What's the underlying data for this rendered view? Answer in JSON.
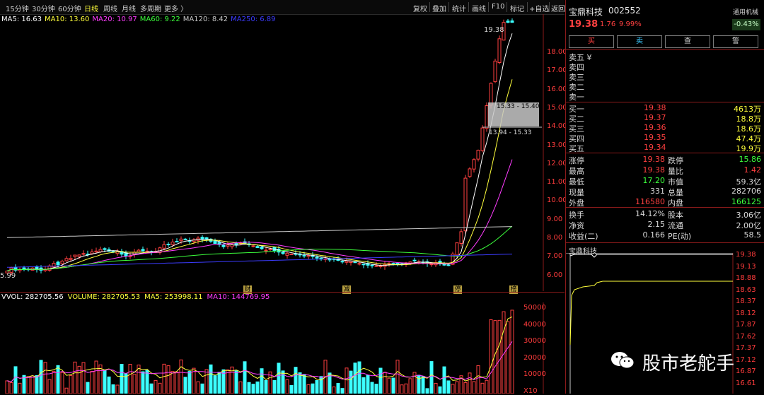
{
  "toolbar": {
    "periods": [
      "15分钟",
      "30分钟",
      "60分钟",
      "日线",
      "周线",
      "月线",
      "多周期",
      "更多 〉"
    ],
    "active_period": "日线",
    "buttons": [
      "复权",
      "叠加",
      "统计",
      "画线",
      "F10",
      "标记",
      "+自选",
      "返回"
    ]
  },
  "ma_legend": [
    {
      "label": "MA5: 16.63",
      "color": "#ffffff"
    },
    {
      "label": "MA10: 13.60",
      "color": "#ffff3c"
    },
    {
      "label": "MA20: 10.97",
      "color": "#ff3cff"
    },
    {
      "label": "MA60: 9.22",
      "color": "#3cff3c"
    },
    {
      "label": "MA120: 8.42",
      "color": "#c8c8c8"
    },
    {
      "label": "MA250: 6.89",
      "color": "#3c3cff"
    }
  ],
  "price_axis": [
    "18.00",
    "17.00",
    "16.00",
    "15.00",
    "14.00",
    "13.00",
    "12.00",
    "11.00",
    "10.00",
    "9.00",
    "8.00",
    "7.00",
    "6.00"
  ],
  "chart_annotations": {
    "high_label": "19.38",
    "low_label": "5.99",
    "range1": "15.33 - 15.40",
    "range2": "13.94 - 15.33"
  },
  "event_markers": [
    "财",
    "减",
    "停",
    "榜"
  ],
  "vol_legend": [
    {
      "label": "VVOL: 282705.56",
      "color": "#ffffff"
    },
    {
      "label": "VOLUME: 282705.53",
      "color": "#ffff3c"
    },
    {
      "label": "MA5: 253998.11",
      "color": "#ffff3c"
    },
    {
      "label": "MA10: 144769.95",
      "color": "#ff3cff"
    }
  ],
  "vol_axis": [
    "50000",
    "40000",
    "30000",
    "20000",
    "10000",
    "X10"
  ],
  "stock": {
    "name": "宝鼎科技",
    "code": "002552",
    "sector": "通用机械",
    "sector_pct": "-0.43%",
    "price": "19.38",
    "change": "1.76",
    "change_pct": "9.99%"
  },
  "trade_buttons": [
    {
      "label": "买",
      "color": "#ff4040"
    },
    {
      "label": "卖",
      "color": "#3cc8ff"
    },
    {
      "label": "查",
      "color": "#d8d8d8"
    },
    {
      "label": "警",
      "color": "#d8d8d8"
    }
  ],
  "sell_book": [
    "卖五 ¥",
    "卖四",
    "卖三",
    "卖二",
    "卖一"
  ],
  "buy_book": [
    {
      "label": "买一",
      "price": "19.38",
      "vol": "4613万"
    },
    {
      "label": "买二",
      "price": "19.37",
      "vol": "18.8万"
    },
    {
      "label": "买三",
      "price": "19.36",
      "vol": "18.6万"
    },
    {
      "label": "买四",
      "price": "19.35",
      "vol": "47.4万"
    },
    {
      "label": "买五",
      "price": "19.34",
      "vol": "19.9万"
    }
  ],
  "stats": [
    {
      "l1": "涨停",
      "v1": "19.38",
      "c1": "#ff4040",
      "l2": "跌停",
      "v2": "15.86",
      "c2": "#3cff3c"
    },
    {
      "l1": "最高",
      "v1": "19.38",
      "c1": "#ff4040",
      "l2": "量比",
      "v2": "1.42",
      "c2": "#ff4040"
    },
    {
      "l1": "最低",
      "v1": "17.20",
      "c1": "#3cff3c",
      "l2": "市值",
      "v2": "59.3亿",
      "c2": "#d8d8d8"
    },
    {
      "l1": "现量",
      "v1": "331",
      "c1": "#d8d8d8",
      "l2": "总量",
      "v2": "282706",
      "c2": "#d8d8d8"
    },
    {
      "l1": "外盘",
      "v1": "116580",
      "c1": "#ff4040",
      "l2": "内盘",
      "v2": "166125",
      "c2": "#3cff3c"
    }
  ],
  "stats2": [
    {
      "l1": "换手",
      "v1": "14.12%",
      "l2": "股本",
      "v2": "3.06亿"
    },
    {
      "l1": "净资",
      "v1": "2.15",
      "l2": "流通",
      "v2": "2.00亿"
    },
    {
      "l1": "收益(二)",
      "v1": "0.166",
      "l2": "PE(动)",
      "v2": "58.5"
    }
  ],
  "mini_chart": {
    "title": "宝鼎科技",
    "axis": [
      "19.38",
      "19.13",
      "18.88",
      "18.63",
      "18.37",
      "18.12",
      "17.87",
      "17.62",
      "17.37",
      "17.12",
      "16.87",
      "16.61"
    ]
  },
  "watermark": "股市老舵手",
  "colors": {
    "up": "#ff4040",
    "down": "#3cffff",
    "accent": "#ffff3c"
  }
}
